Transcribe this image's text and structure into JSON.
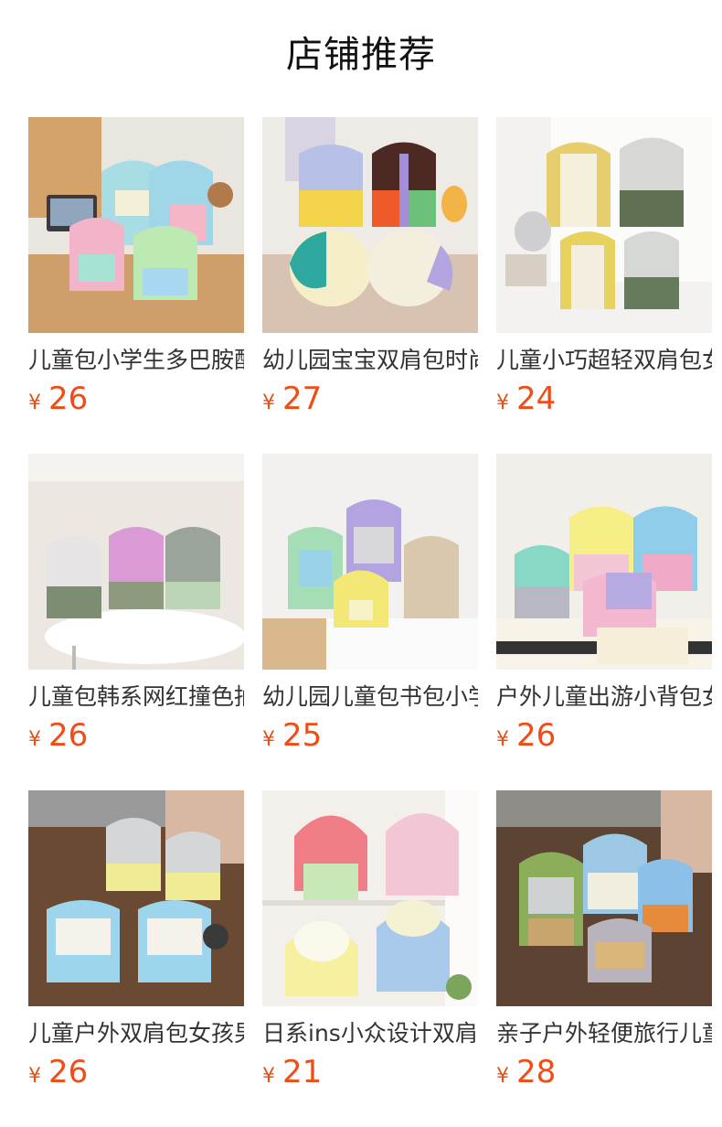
{
  "header": {
    "title": "店铺推荐"
  },
  "currency_symbol": "¥",
  "products": [
    {
      "name": "儿童包小学生多巴胺配色双肩包",
      "price": "26",
      "image": "pastel-backpacks-on-desk"
    },
    {
      "name": "幼儿园宝宝双肩包时尚撞色",
      "price": "27",
      "image": "colorblock-backpacks-on-table"
    },
    {
      "name": "儿童小巧超轻双肩包女",
      "price": "24",
      "image": "yellow-green-backpacks-on-pegboard"
    },
    {
      "name": "儿童包韩系网红撞色抽绳",
      "price": "26",
      "image": "drawstring-backpacks-on-round-table"
    },
    {
      "name": "幼儿园儿童包书包小学生",
      "price": "25",
      "image": "green-purple-beige-backpacks"
    },
    {
      "name": "户外儿童出游小背包女孩",
      "price": "26",
      "image": "pink-blue-backpacks-with-tote"
    },
    {
      "name": "儿童户外双肩包女孩男孩",
      "price": "26",
      "image": "outdoor-blue-backpacks-on-ground"
    },
    {
      "name": "日系ins小众设计双肩包",
      "price": "21",
      "image": "fruit-shaped-backpacks"
    },
    {
      "name": "亲子户外轻便旅行儿童包",
      "price": "28",
      "image": "canvas-backpacks-outdoor"
    }
  ]
}
